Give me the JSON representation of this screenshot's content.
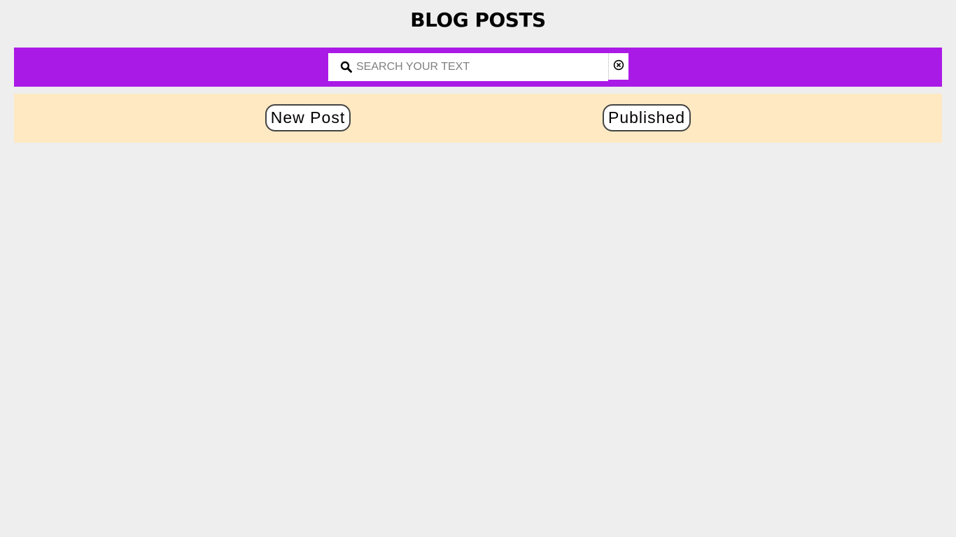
{
  "header": {
    "title": "BLOG POSTS"
  },
  "search": {
    "placeholder": "SEARCH YOUR TEXT",
    "value": "",
    "icon": "search-icon",
    "clear_icon": "close-circle-icon"
  },
  "actions": {
    "new_post_label": "New Post",
    "published_label": "Published"
  },
  "colors": {
    "page_background": "#eeeeee",
    "search_bar": "#aa1ae6",
    "action_bar": "#ffe9c2"
  }
}
